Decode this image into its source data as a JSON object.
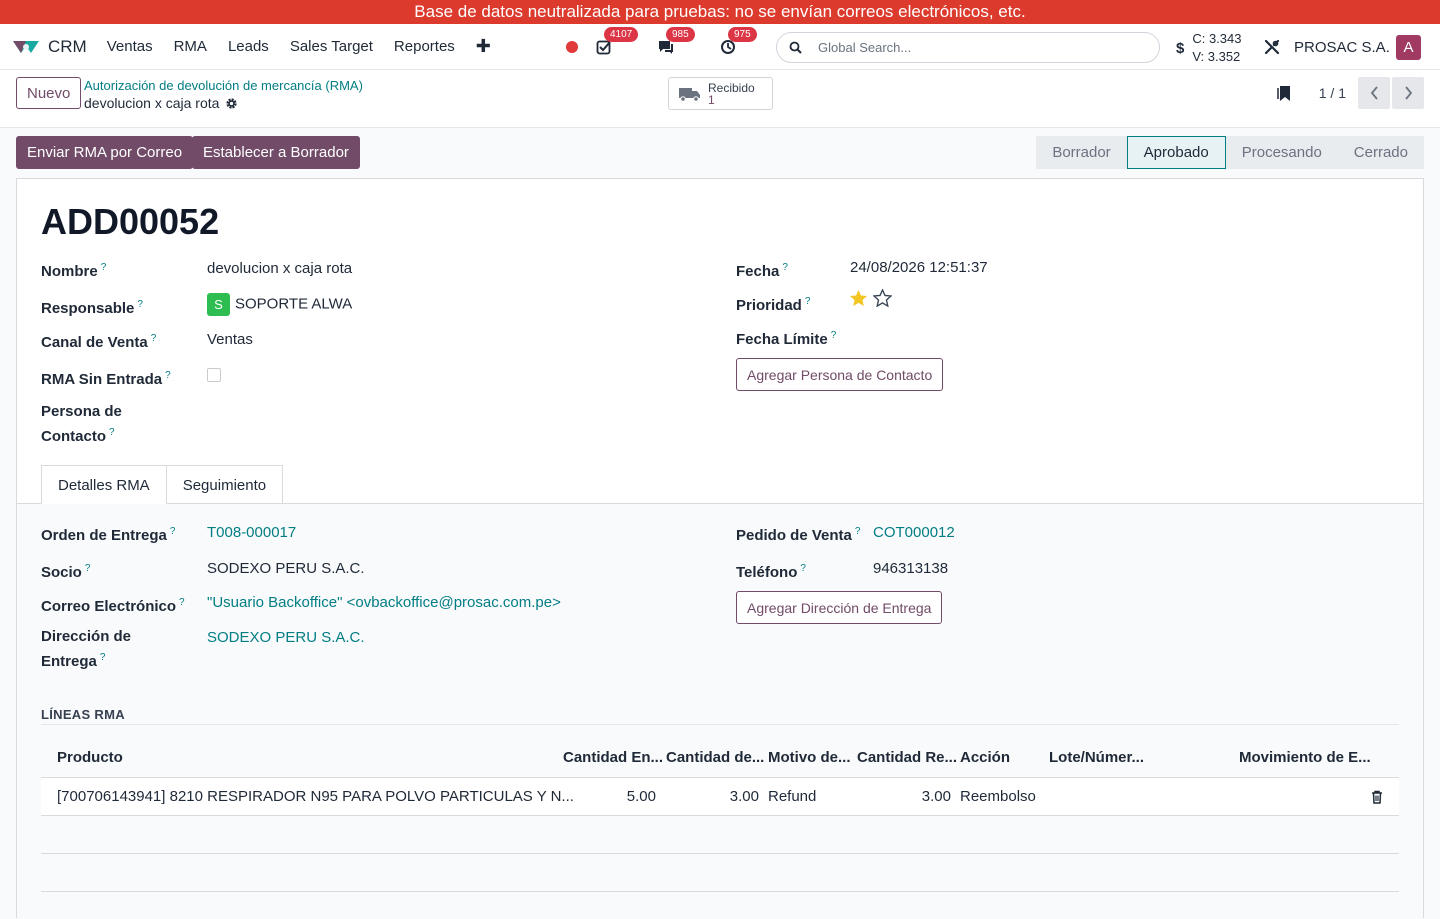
{
  "banner": "Base de datos neutralizada para pruebas: no se envían correos electrónicos, etc.",
  "navbar": {
    "app_name": "CRM",
    "menu": [
      "Ventas",
      "RMA",
      "Leads",
      "Sales Target",
      "Reportes"
    ],
    "badges": {
      "activities": "4107",
      "messages": "985",
      "timers": "975"
    },
    "search_placeholder": "Global Search...",
    "currency_symbol": "$",
    "rate_c": "C: 3.343",
    "rate_v": "V: 3.352",
    "company": "PROSAC S.A.",
    "user_initial": "A"
  },
  "control": {
    "new_label": "Nuevo",
    "breadcrumb_parent": "Autorización de devolución de mercancía (RMA)",
    "breadcrumb_current": "devolucion x caja rota",
    "smart_label": "Recibido",
    "smart_value": "1",
    "pager": "1 / 1"
  },
  "actions": {
    "send_email": "Enviar RMA por Correo",
    "set_draft": "Establecer a Borrador"
  },
  "stages": [
    "Borrador",
    "Aprobado",
    "Procesando",
    "Cerrado"
  ],
  "active_stage": "Aprobado",
  "record": {
    "title": "ADD00052",
    "labels": {
      "nombre": "Nombre",
      "responsable": "Responsable",
      "canal": "Canal de Venta",
      "sin_entrada": "RMA Sin Entrada",
      "persona1": "Persona de",
      "persona2": "Contacto",
      "fecha": "Fecha",
      "prioridad": "Prioridad",
      "fecha_limite": "Fecha Límite"
    },
    "nombre": "devolucion x caja rota",
    "responsable_initial": "S",
    "responsable": "SOPORTE ALWA",
    "canal": "Ventas",
    "rma_sin_entrada": false,
    "fecha": "24/08/2026 12:51:37",
    "prioridad_stars": 1,
    "add_contact": "Agregar Persona de Contacto"
  },
  "tabs": [
    "Detalles RMA",
    "Seguimiento"
  ],
  "details": {
    "labels": {
      "orden": "Orden de Entrega",
      "socio": "Socio",
      "correo": "Correo Electrónico",
      "direccion1": "Dirección de",
      "direccion2": "Entrega",
      "pedido": "Pedido de Venta",
      "telefono": "Teléfono"
    },
    "orden": "T008-000017",
    "socio": "SODEXO PERU S.A.C.",
    "correo": "\"Usuario Backoffice\" <ovbackoffice@prosac.com.pe>",
    "direccion": "SODEXO PERU S.A.C.",
    "pedido": "COT000012",
    "telefono": "946313138",
    "add_address": "Agregar Dirección de Entrega"
  },
  "lines": {
    "title": "LÍNEAS RMA",
    "headers": [
      "Producto",
      "Cantidad En...",
      "Cantidad de...",
      "Motivo de...",
      "Cantidad Re...",
      "Acción",
      "Lote/Númer...",
      "Movimiento de E..."
    ],
    "rows": [
      {
        "producto": "[700706143941] 8210 RESPIRADOR N95 PARA POLVO PARTICULAS Y N...",
        "cant_en": "5.00",
        "cant_de": "3.00",
        "motivo": "Refund",
        "cant_re": "3.00",
        "accion": "Reembolso"
      }
    ]
  },
  "colors": {
    "brand": "#714b67",
    "link": "#017e84",
    "banner": "#dc3a2d",
    "badge": "#dc3545"
  }
}
